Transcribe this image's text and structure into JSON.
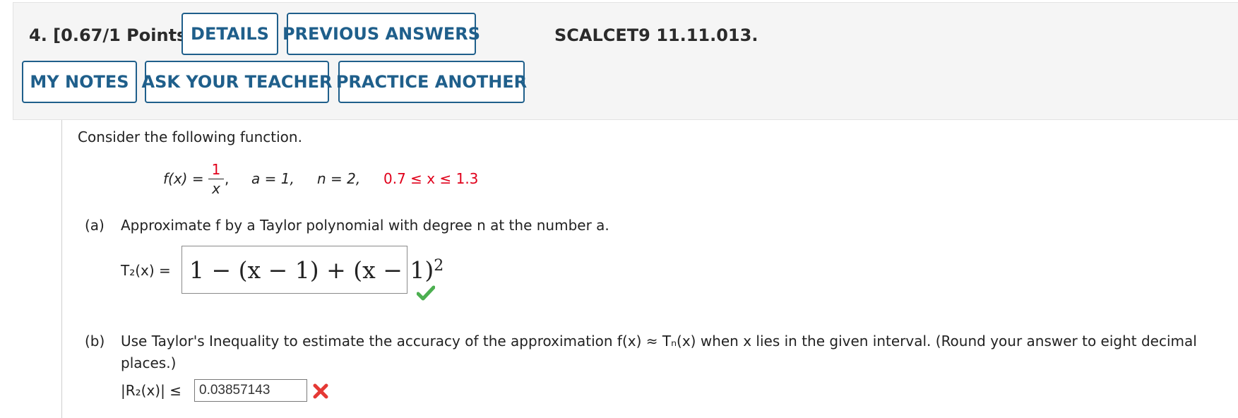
{
  "header": {
    "question_label": "4.  [0.67/1 Points]",
    "details_btn": "DETAILS",
    "prev_answers_btn": "PREVIOUS ANSWERS",
    "code": "SCALCET9 11.11.013.",
    "my_notes_btn": "MY NOTES",
    "ask_teacher_btn": "ASK YOUR TEACHER",
    "practice_btn": "PRACTICE ANOTHER"
  },
  "problem": {
    "intro": "Consider the following function.",
    "func_lhs": "f(x)",
    "func_eq": "=",
    "frac_num": "1",
    "frac_den": "x",
    "comma": ",",
    "a_value": "a = 1,",
    "n_value": "n = 2,",
    "interval": "0.7 ≤ x ≤ 1.3"
  },
  "part_a": {
    "label": "(a)",
    "text": "Approximate f by a Taylor polynomial with degree n at the number a.",
    "lhs": "T₂(x) =",
    "answer": "1 − (x − 1) + (x − 1)",
    "answer_exp": "2",
    "status": "correct"
  },
  "part_b": {
    "label": "(b)",
    "text_line1": "Use Taylor's Inequality to estimate the accuracy of the approximation f(x) ≈ Tₙ(x) when x lies in the given interval. (Round your answer to eight decimal",
    "text_line2": "places.)",
    "lhs": "|R₂(x)| ≤",
    "answer": "0.03857143",
    "status": "incorrect"
  },
  "colors": {
    "accent": "#1f5f8b",
    "red": "#e0001b",
    "check": "#4caf50",
    "cross": "#e53935"
  }
}
